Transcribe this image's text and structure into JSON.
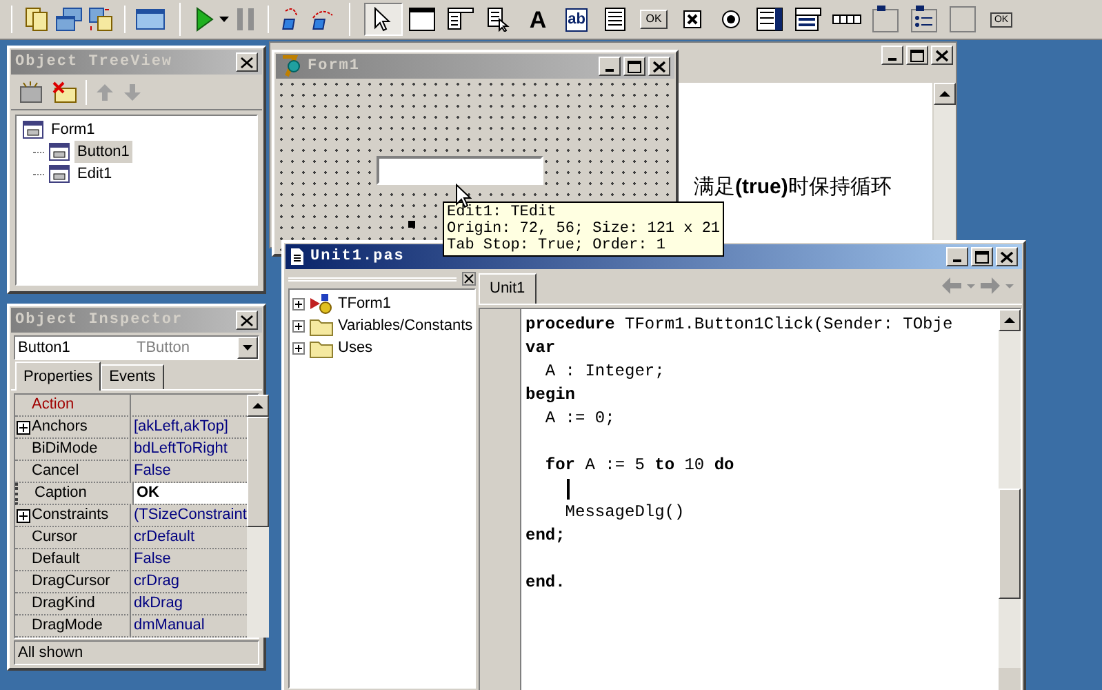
{
  "palette": [
    {
      "kind": "pointer",
      "selected": true
    },
    {
      "kind": "frame",
      "selected": false
    },
    {
      "kind": "main-menu",
      "selected": false
    },
    {
      "kind": "popup-menu",
      "selected": false
    },
    {
      "kind": "label",
      "glyph": "A",
      "selected": false
    },
    {
      "kind": "edit",
      "glyph": "ab",
      "selected": false
    },
    {
      "kind": "memo",
      "selected": false
    },
    {
      "kind": "button",
      "glyph": "OK",
      "selected": false
    },
    {
      "kind": "checkbox",
      "selected": false
    },
    {
      "kind": "radio",
      "selected": false
    },
    {
      "kind": "listbox",
      "selected": false
    },
    {
      "kind": "combobox",
      "selected": false
    },
    {
      "kind": "scrollbar",
      "selected": false
    },
    {
      "kind": "groupbox",
      "selected": false
    },
    {
      "kind": "radiogroup",
      "selected": false
    },
    {
      "kind": "panel",
      "selected": false
    },
    {
      "kind": "action-list",
      "glyph": "OK",
      "selected": false
    }
  ],
  "tree_view": {
    "title": "Object TreeView",
    "items": [
      {
        "label": "Form1",
        "selected": false,
        "children": [
          {
            "label": "Button1",
            "selected": true
          },
          {
            "label": "Edit1",
            "selected": false
          }
        ]
      }
    ]
  },
  "inspector": {
    "title": "Object Inspector",
    "object": "Button1",
    "object_type": "TButton",
    "tabs": [
      {
        "label": "Properties",
        "selected": true
      },
      {
        "label": "Events",
        "selected": false
      }
    ],
    "properties": [
      {
        "name": "Action",
        "kind": "reference",
        "expandable": false,
        "selected": false
      },
      {
        "name": "Anchors",
        "value": "[akLeft,akTop]",
        "kind": "plain",
        "expandable": true,
        "selected": false
      },
      {
        "name": "BiDiMode",
        "value": "bdLeftToRight",
        "kind": "plain",
        "expandable": false,
        "selected": false
      },
      {
        "name": "Cancel",
        "value": "False",
        "kind": "plain",
        "expandable": false,
        "selected": false
      },
      {
        "name": "Caption",
        "value": "OK",
        "kind": "plain",
        "expandable": false,
        "selected": true
      },
      {
        "name": "Constraints",
        "value": "(TSizeConstraint",
        "kind": "plain",
        "expandable": true,
        "selected": false
      },
      {
        "name": "Cursor",
        "value": "crDefault",
        "kind": "plain",
        "expandable": false,
        "selected": false
      },
      {
        "name": "Default",
        "value": "False",
        "kind": "plain",
        "expandable": false,
        "selected": false
      },
      {
        "name": "DragCursor",
        "value": "crDrag",
        "kind": "plain",
        "expandable": false,
        "selected": false
      },
      {
        "name": "DragKind",
        "value": "dkDrag",
        "kind": "plain",
        "expandable": false,
        "selected": false
      },
      {
        "name": "DragMode",
        "value": "dmManual",
        "kind": "plain",
        "expandable": false,
        "selected": false
      }
    ],
    "status": "All shown"
  },
  "background_window": {
    "text": "满足**(true)**时保持循环"
  },
  "form": {
    "title": "Form1"
  },
  "tooltip": {
    "lines": [
      "Edit1: TEdit",
      "Origin: 72, 56; Size: 121 x 21",
      "Tab Stop: True; Order: 1"
    ]
  },
  "editor": {
    "title": "Unit1.pas",
    "explorer": [
      {
        "label": "TForm1",
        "kind": "class"
      },
      {
        "label": "Variables/Constants",
        "kind": "folder"
      },
      {
        "label": "Uses",
        "kind": "folder"
      }
    ],
    "tabs": [
      {
        "label": "Unit1",
        "selected": true
      }
    ],
    "code": [
      {
        "kind": "code",
        "text": "**procedure** TForm1.Button1Click(Sender: TObje"
      },
      {
        "kind": "code",
        "text": "**var**"
      },
      {
        "kind": "code",
        "text": "  A : Integer;"
      },
      {
        "kind": "code",
        "text": "**begin**"
      },
      {
        "kind": "code",
        "text": "  A := 0;"
      },
      {
        "kind": "blank"
      },
      {
        "kind": "code",
        "text": "  **for** A := 5 **to** 10 **do**"
      },
      {
        "kind": "caret"
      },
      {
        "kind": "code",
        "text": "    MessageDlg()"
      },
      {
        "kind": "code",
        "text": "**end;**"
      },
      {
        "kind": "blank"
      },
      {
        "kind": "code",
        "text": "**end.**"
      }
    ]
  }
}
